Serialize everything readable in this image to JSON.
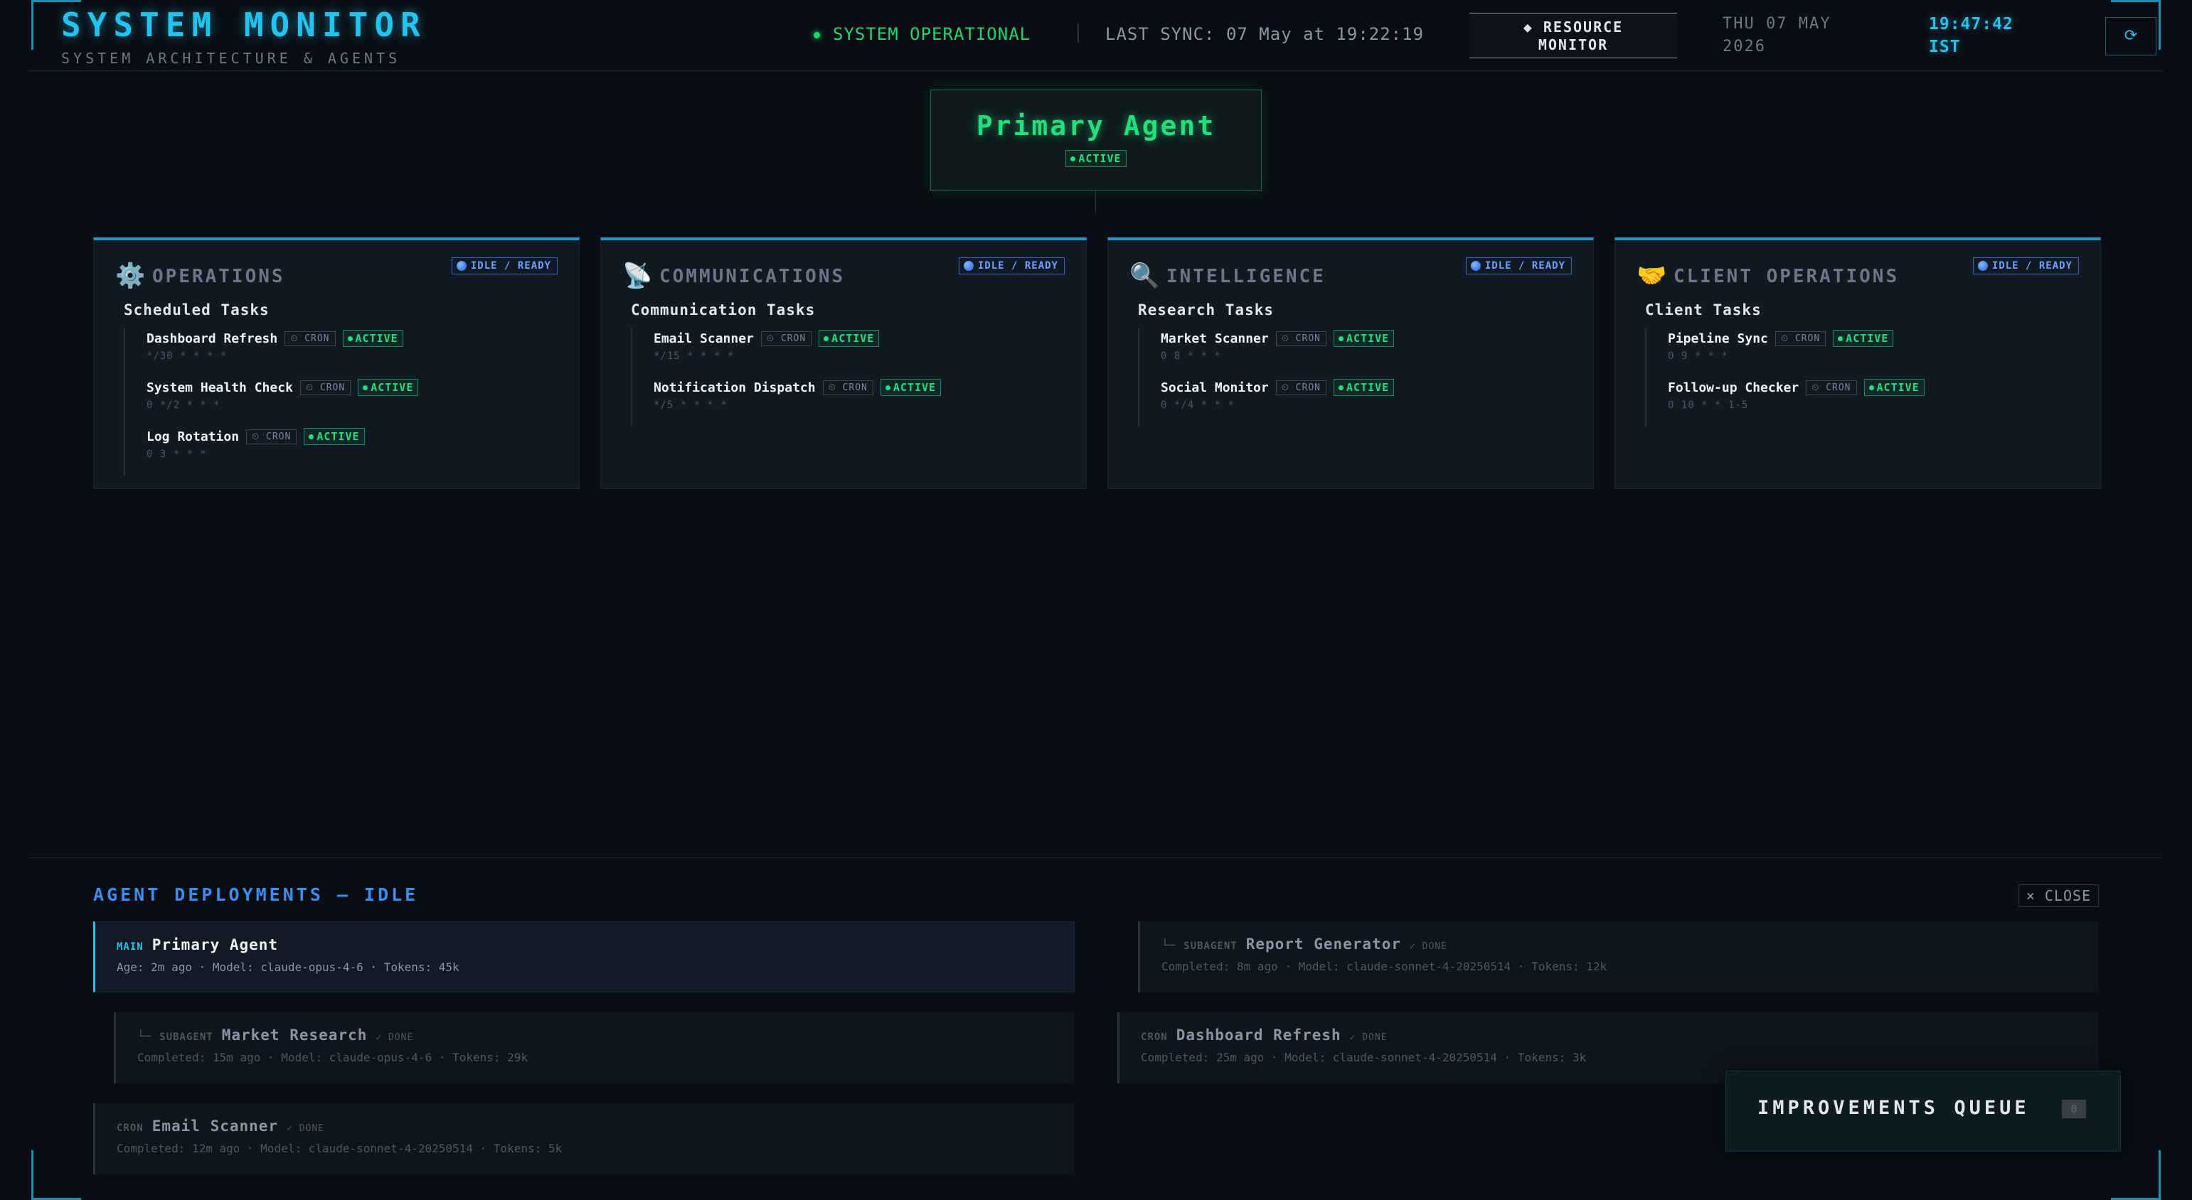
{
  "header": {
    "title": "SYSTEM MONITOR",
    "subtitle": "SYSTEM ARCHITECTURE & AGENTS",
    "status": "SYSTEM OPERATIONAL",
    "separator": "|",
    "last_sync": "LAST SYNC: 07 May at 19:22:19",
    "resource_monitor_line1": "◆ RESOURCE",
    "resource_monitor_line2": "MONITOR",
    "date_line1": "THU 07 MAY",
    "date_line2": "2026",
    "time": "19:47:42",
    "timezone": "IST",
    "refresh_icon": "⟳"
  },
  "primary_agent": {
    "name": "Primary Agent",
    "status": "ACTIVE"
  },
  "departments": [
    {
      "icon": "⚙️",
      "title": "OPERATIONS",
      "status": "IDLE / READY",
      "group": "Scheduled Tasks",
      "tasks": [
        {
          "name": "Dashboard Refresh",
          "type": "⏲ CRON",
          "status": "ACTIVE",
          "schedule": "*/30 * * * *"
        },
        {
          "name": "System Health Check",
          "type": "⏲ CRON",
          "status": "ACTIVE",
          "schedule": "0 */2 * * *"
        },
        {
          "name": "Log Rotation",
          "type": "⏲ CRON",
          "status": "ACTIVE",
          "schedule": "0 3 * * *"
        }
      ]
    },
    {
      "icon": "📡",
      "title": "COMMUNICATIONS",
      "status": "IDLE / READY",
      "group": "Communication Tasks",
      "tasks": [
        {
          "name": "Email Scanner",
          "type": "⏲ CRON",
          "status": "ACTIVE",
          "schedule": "*/15 * * * *"
        },
        {
          "name": "Notification Dispatch",
          "type": "⏲ CRON",
          "status": "ACTIVE",
          "schedule": "*/5 * * * *"
        }
      ]
    },
    {
      "icon": "🔍",
      "title": "INTELLIGENCE",
      "status": "IDLE / READY",
      "group": "Research Tasks",
      "tasks": [
        {
          "name": "Market Scanner",
          "type": "⏲ CRON",
          "status": "ACTIVE",
          "schedule": "0 8 * * *"
        },
        {
          "name": "Social Monitor",
          "type": "⏲ CRON",
          "status": "ACTIVE",
          "schedule": "0 */4 * * *"
        }
      ]
    },
    {
      "icon": "🤝",
      "title": "CLIENT OPERATIONS",
      "status": "IDLE / READY",
      "group": "Client Tasks",
      "tasks": [
        {
          "name": "Pipeline Sync",
          "type": "⏲ CRON",
          "status": "ACTIVE",
          "schedule": "0 9 * * *"
        },
        {
          "name": "Follow-up Checker",
          "type": "⏲ CRON",
          "status": "ACTIVE",
          "schedule": "0 10 * * 1-5"
        }
      ]
    }
  ],
  "deployments": {
    "title": "AGENT DEPLOYMENTS — IDLE",
    "close_label": "× CLOSE",
    "items": [
      {
        "tree": "",
        "type": "MAIN",
        "name": "Primary Agent",
        "done": "",
        "meta": "Age: 2m ago  ·  Model: claude-opus-4-6  ·  Tokens: 45k"
      },
      {
        "tree": "└─",
        "type": "SUBAGENT",
        "name": "Report Generator",
        "done": "✓ DONE",
        "meta": "Completed: 8m ago  ·  Model: claude-sonnet-4-20250514  ·  Tokens: 12k"
      },
      {
        "tree": "└─",
        "type": "SUBAGENT",
        "name": "Market Research",
        "done": "✓ DONE",
        "meta": "Completed: 15m ago  ·  Model: claude-opus-4-6  ·  Tokens: 29k"
      },
      {
        "tree": "",
        "type": "CRON",
        "name": "Dashboard Refresh",
        "done": "✓ DONE",
        "meta": "Completed: 25m ago  ·  Model: claude-sonnet-4-20250514  ·  Tokens: 3k"
      },
      {
        "tree": "",
        "type": "CRON",
        "name": "Email Scanner",
        "done": "✓ DONE",
        "meta": "Completed: 12m ago  ·  Model: claude-sonnet-4-20250514  ·  Tokens: 5k"
      }
    ]
  },
  "improvements": {
    "label": "IMPROVEMENTS QUEUE",
    "count": "0"
  }
}
